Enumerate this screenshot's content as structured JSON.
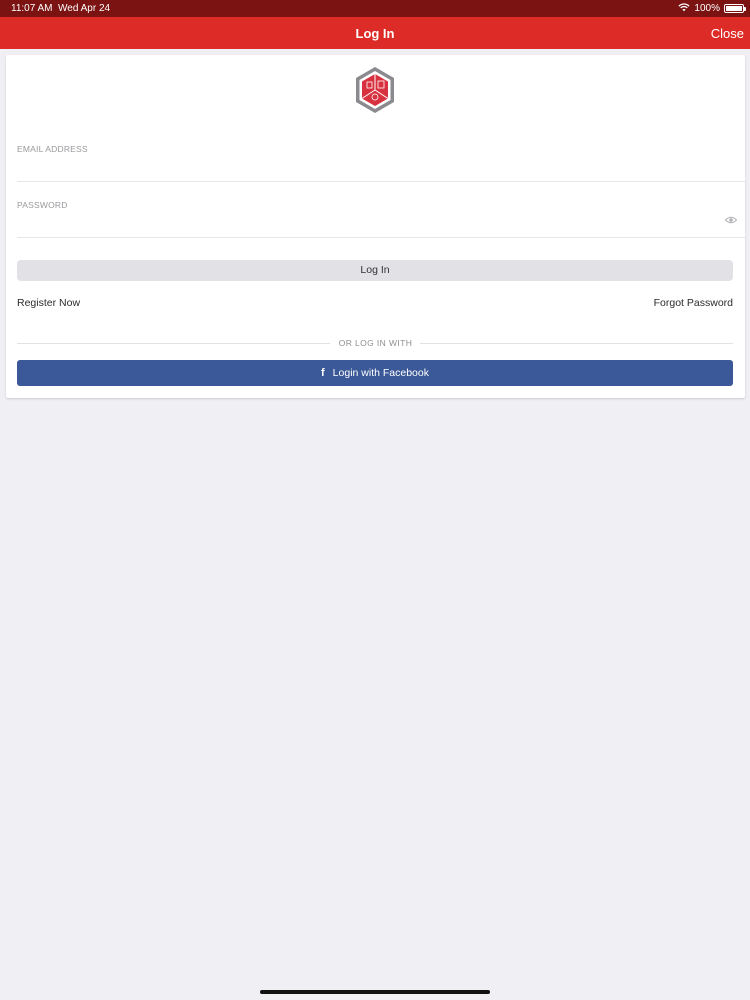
{
  "status_bar": {
    "time": "11:07 AM",
    "date": "Wed Apr 24",
    "battery_text": "100%",
    "battery_level": 1.0,
    "icons": [
      "wifi-icon",
      "battery-icon"
    ]
  },
  "nav": {
    "title": "Log In",
    "close_label": "Close",
    "color": "#dd2c27"
  },
  "form": {
    "email": {
      "label": "EMAIL ADDRESS",
      "value": "",
      "placeholder": ""
    },
    "password": {
      "label": "PASSWORD",
      "value": "",
      "placeholder": ""
    },
    "login_button_label": "Log In",
    "register_label": "Register Now",
    "forgot_label": "Forgot Password",
    "divider_text": "OR LOG IN WITH",
    "facebook_button_label": "Login with Facebook",
    "facebook_color": "#3b5998"
  },
  "logo": {
    "icon": "hexagon-logo-icon",
    "colors": [
      "#d8313f",
      "#7d7d82"
    ]
  }
}
